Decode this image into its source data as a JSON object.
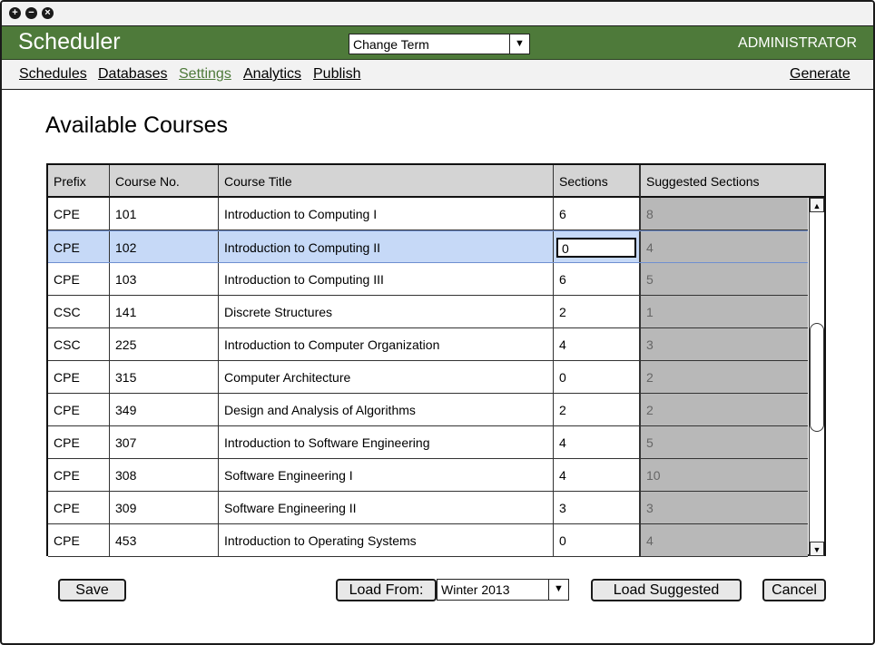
{
  "app": {
    "title": "Scheduler",
    "role": "ADMINISTRATOR"
  },
  "term_select": {
    "value": "Change Term"
  },
  "nav": {
    "items": [
      {
        "label": "Schedules"
      },
      {
        "label": "Databases"
      },
      {
        "label": "Settings",
        "active": true
      },
      {
        "label": "Analytics"
      },
      {
        "label": "Publish"
      }
    ],
    "generate": "Generate"
  },
  "page": {
    "title": "Available Courses"
  },
  "table": {
    "headers": [
      "Prefix",
      "Course No.",
      "Course Title",
      "Sections",
      "Suggested Sections"
    ],
    "rows": [
      {
        "prefix": "CPE",
        "number": "101",
        "title": "Introduction to Computing I",
        "sections": "6",
        "suggested": "8"
      },
      {
        "prefix": "CPE",
        "number": "102",
        "title": "Introduction to Computing II",
        "sections": "0",
        "suggested": "4",
        "selected": true
      },
      {
        "prefix": "CPE",
        "number": "103",
        "title": "Introduction to Computing III",
        "sections": "6",
        "suggested": "5"
      },
      {
        "prefix": "CSC",
        "number": "141",
        "title": "Discrete Structures",
        "sections": "2",
        "suggested": "1"
      },
      {
        "prefix": "CSC",
        "number": "225",
        "title": "Introduction to Computer Organization",
        "sections": "4",
        "suggested": "3"
      },
      {
        "prefix": "CPE",
        "number": "315",
        "title": "Computer Architecture",
        "sections": "0",
        "suggested": "2"
      },
      {
        "prefix": "CPE",
        "number": "349",
        "title": "Design and Analysis of Algorithms",
        "sections": "2",
        "suggested": "2"
      },
      {
        "prefix": "CPE",
        "number": "307",
        "title": "Introduction to Software Engineering",
        "sections": "4",
        "suggested": "5"
      },
      {
        "prefix": "CPE",
        "number": "308",
        "title": "Software Engineering I",
        "sections": "4",
        "suggested": "10"
      },
      {
        "prefix": "CPE",
        "number": "309",
        "title": "Software Engineering II",
        "sections": "3",
        "suggested": "3"
      },
      {
        "prefix": "CPE",
        "number": "453",
        "title": "Introduction to Operating Systems",
        "sections": "0",
        "suggested": "4"
      }
    ]
  },
  "footer": {
    "save": "Save",
    "load_from": "Load From:",
    "load_from_value": "Winter 2013",
    "load_suggested": "Load Suggested",
    "cancel": "Cancel"
  },
  "colors": {
    "brand": "#4e7a3a",
    "selected_row": "#c6d9f7",
    "suggested_col": "#b8b8b8"
  },
  "icons": [
    "plus-icon",
    "minus-icon",
    "close-icon",
    "chevron-down-icon",
    "arrow-up-icon",
    "arrow-down-icon"
  ]
}
